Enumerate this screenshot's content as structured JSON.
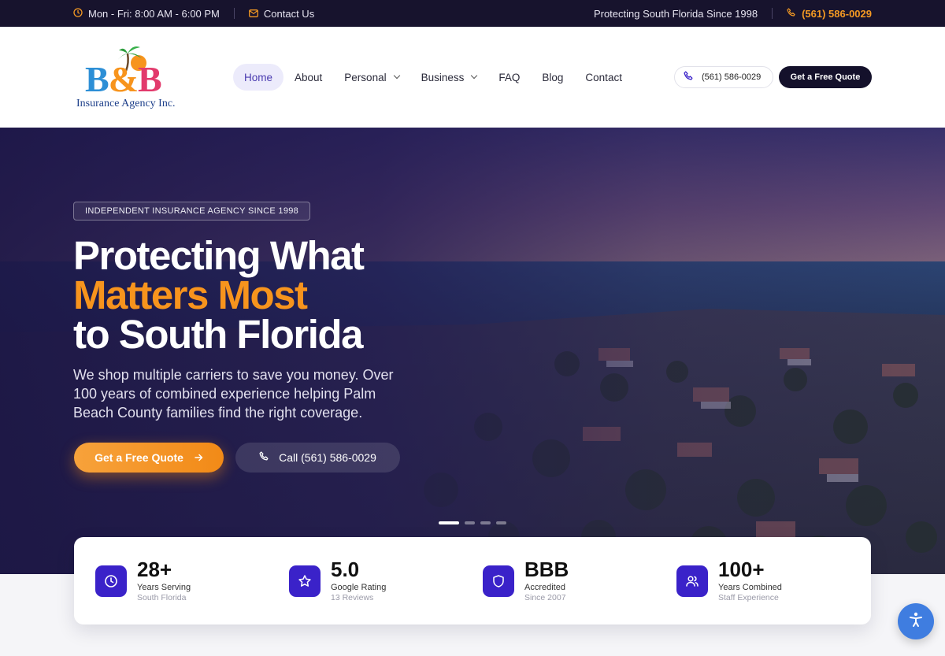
{
  "topbar": {
    "hours": "Mon - Fri: 8:00 AM - 6:00 PM",
    "contact": "Contact Us",
    "tagline": "Protecting South Florida Since 1998",
    "phone": "(561) 586-0029"
  },
  "logo": {
    "mark": "B&B",
    "name": "Insurance Agency Inc."
  },
  "nav": {
    "items": [
      {
        "label": "Home"
      },
      {
        "label": "About"
      },
      {
        "label": "Personal"
      },
      {
        "label": "Business"
      },
      {
        "label": "FAQ"
      },
      {
        "label": "Blog"
      },
      {
        "label": "Contact"
      }
    ],
    "active": "Home"
  },
  "header": {
    "phone": "(561) 586-0029",
    "quote": "Get a Free Quote"
  },
  "hero": {
    "badge": "INDEPENDENT INSURANCE AGENCY SINCE 1998",
    "line1": "Protecting What",
    "line2": "Matters Most",
    "line3": "to South Florida",
    "subtitle": "We shop multiple carriers to save you money. Over 100 years of combined experience helping Palm Beach County families find the right coverage.",
    "cta_quote": "Get a Free Quote",
    "cta_call": "Call (561) 586-0029",
    "slides": 4,
    "active_slide": 1
  },
  "stats": [
    {
      "value": "28+",
      "label": "Years Serving",
      "sub": "South Florida",
      "icon": "clock-icon"
    },
    {
      "value": "5.0",
      "label": "Google Rating",
      "sub": "13 Reviews",
      "icon": "star-icon"
    },
    {
      "value": "BBB",
      "label": "Accredited",
      "sub": "Since 2007",
      "icon": "shield-icon"
    },
    {
      "value": "100+",
      "label": "Years Combined",
      "sub": "Staff Experience",
      "icon": "users-icon"
    }
  ],
  "colors": {
    "accent": "#f7941d",
    "brand": "#3a22c9",
    "dark": "#17132d"
  }
}
